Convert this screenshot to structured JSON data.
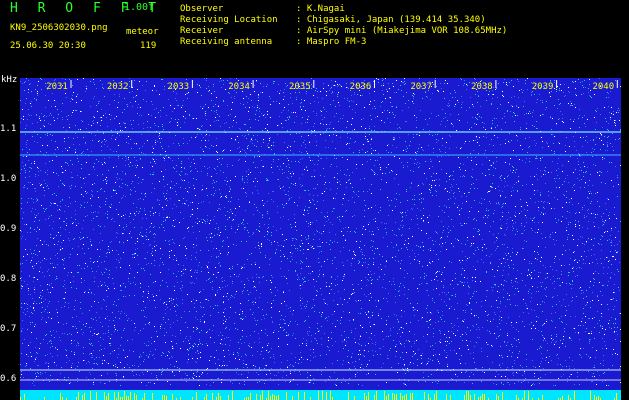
{
  "header": {
    "app_title": "H R O F F T",
    "version": "1.00f",
    "filename": "KN9_2506302030.png",
    "mode": "meteor",
    "datetime": "25.06.30 20:30",
    "count": "119",
    "meta": [
      {
        "label": "Observer",
        "value": ": K.Nagai"
      },
      {
        "label": "Receiving Location",
        "value": ": Chigasaki, Japan (139.414 35.340)"
      },
      {
        "label": "Receiver",
        "value": ": AirSpy mini (Miakejima VOR 108.65MHz)"
      },
      {
        "label": "Receiving antenna",
        "value": ": Maspro FM-3"
      }
    ]
  },
  "spectrogram": {
    "unit_label": "kHz",
    "y_ticks": [
      "1.1",
      "1.0",
      "0.9",
      "0.8",
      "0.7",
      "0.6"
    ],
    "x_ticks": [
      "2031",
      "2032",
      "2033",
      "2034",
      "2035",
      "2036",
      "2037",
      "2038",
      "2039",
      "2040"
    ],
    "colors": {
      "background": "#1a1ad0",
      "noise_dim": "#3a6cff",
      "noise_mid": "#24c8d8",
      "noise_bright": "#ffffff",
      "bottom_band": "#00e5ff",
      "bottom_spikes": "#ffff00"
    }
  }
}
